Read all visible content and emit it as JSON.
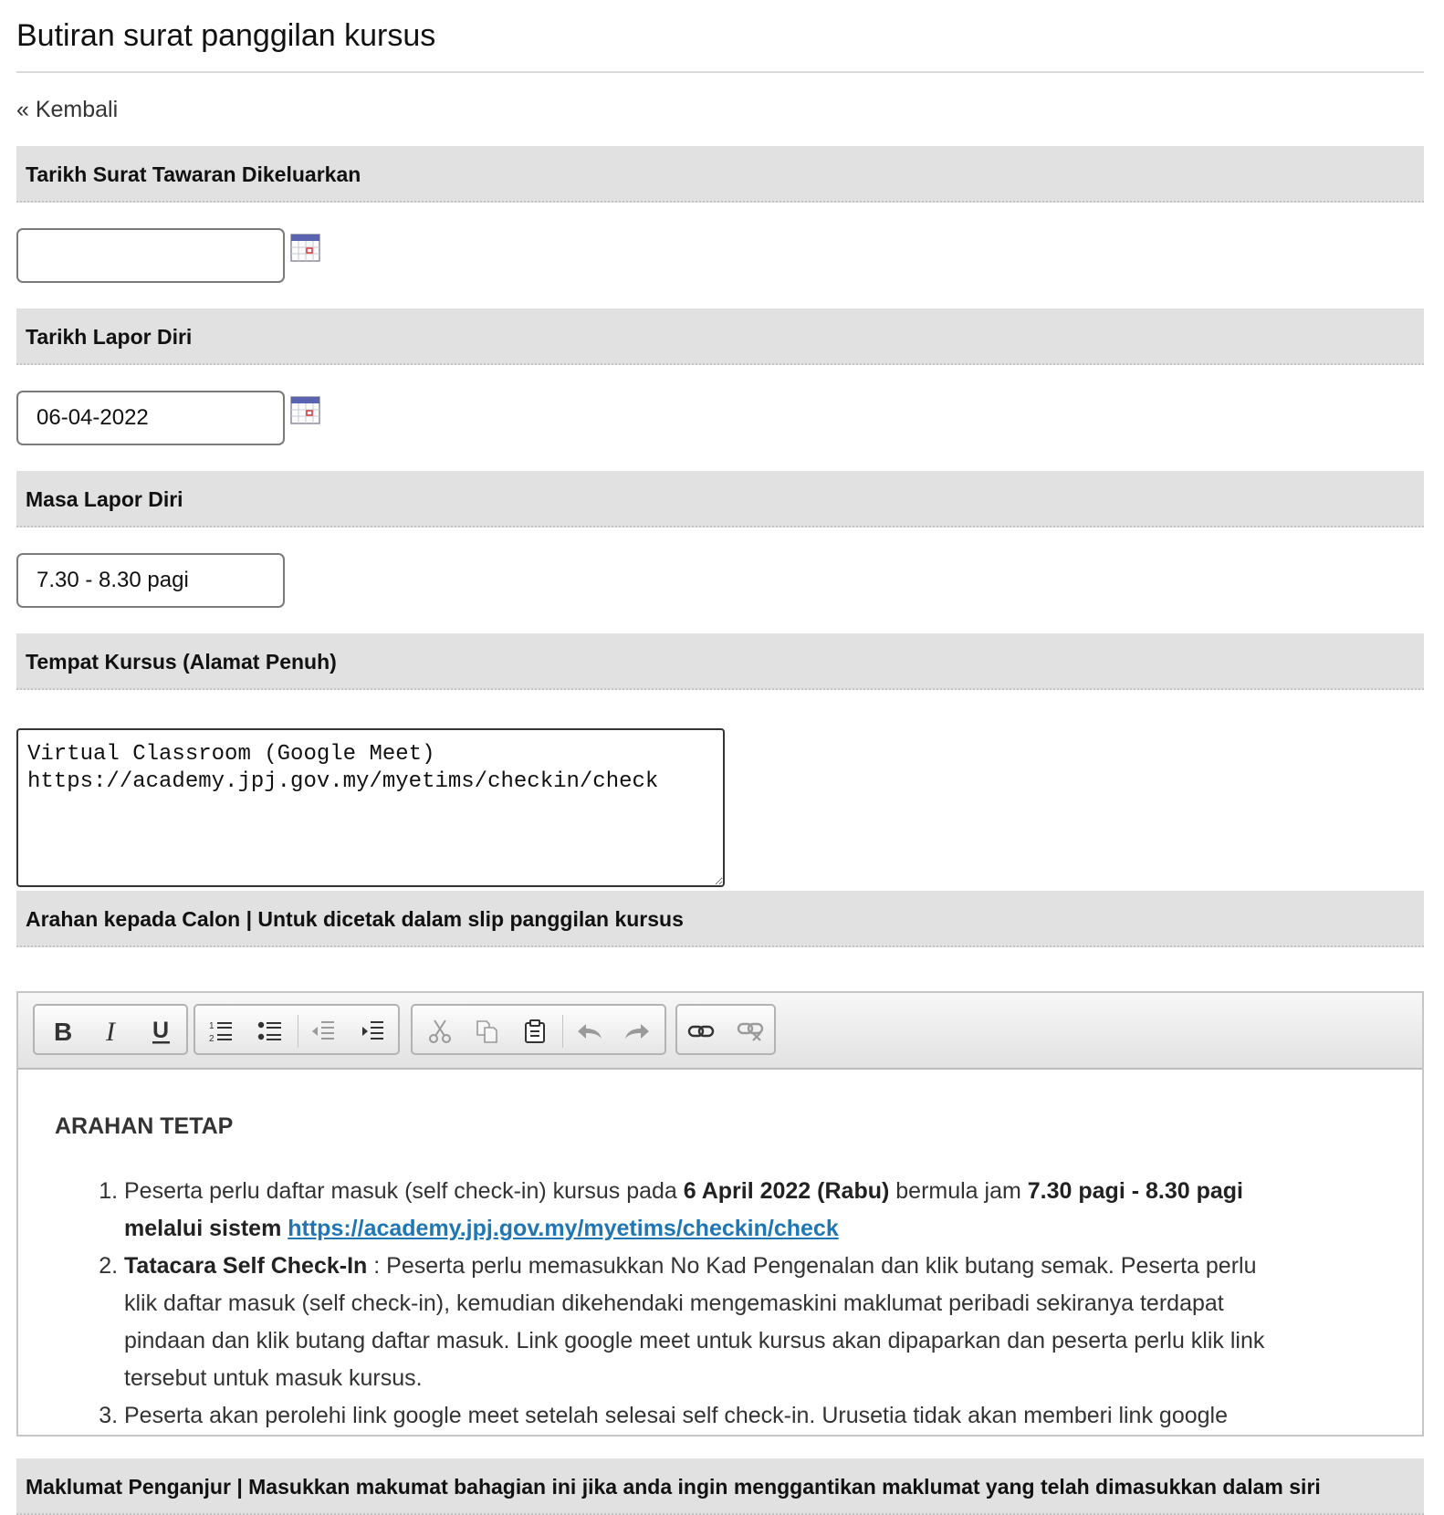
{
  "page": {
    "title": "Butiran surat panggilan kursus",
    "back_link": "« Kembali"
  },
  "fields": {
    "tarikh_surat": {
      "label": "Tarikh Surat Tawaran Dikeluarkan",
      "value": ""
    },
    "tarikh_lapor": {
      "label": "Tarikh Lapor Diri",
      "value": "06-04-2022"
    },
    "masa_lapor": {
      "label": "Masa Lapor Diri",
      "value": "7.30 - 8.30 pagi"
    },
    "tempat": {
      "label": "Tempat Kursus (Alamat Penuh)",
      "value": "Virtual Classroom (Google Meet)\nhttps://academy.jpj.gov.my/myetims/checkin/check"
    },
    "arahan": {
      "label": "Arahan kepada Calon | Untuk dicetak dalam slip panggilan kursus"
    },
    "penganjur": {
      "label": "Maklumat Penganjur | Masukkan makumat bahagian ini jika anda ingin menggantikan maklumat yang telah dimasukkan dalam siri"
    }
  },
  "toolbar": {
    "groups": [
      [
        "bold-icon",
        "italic-icon",
        "underline-icon"
      ],
      [
        "numbered-list-icon",
        "bullet-list-icon",
        "outdent-icon",
        "indent-icon"
      ],
      [
        "cut-icon",
        "copy-icon",
        "paste-icon",
        "undo-icon",
        "redo-icon"
      ],
      [
        "link-icon",
        "unlink-icon"
      ]
    ]
  },
  "editor": {
    "heading": "ARAHAN TETAP",
    "items": [
      {
        "t1": "Peserta perlu daftar masuk (self check-in) kursus pada ",
        "b1": "6 April 2022 (Rabu)",
        "t2": " bermula jam ",
        "b2": "7.30 pagi - 8.30 pagi melalui sistem ",
        "link": "https://academy.jpj.gov.my/myetims/checkin/check"
      },
      {
        "b1": "Tatacara Self Check-In",
        "t1": " : Peserta perlu memasukkan No Kad Pengenalan dan klik butang semak. Peserta perlu klik daftar masuk (self check-in), kemudian dikehendaki mengemaskini maklumat peribadi sekiranya terdapat pindaan dan klik butang daftar masuk. Link google meet untuk kursus akan dipaparkan dan peserta perlu klik link tersebut untuk masuk kursus."
      },
      {
        "t1": "Peserta akan perolehi link google meet setelah selesai self check-in. Urusetia tidak akan memberi link google"
      }
    ]
  },
  "colors": {
    "section_bg": "#e1e1e1",
    "link": "#1f76b5",
    "toolbar_bg": "#eeeeee"
  }
}
